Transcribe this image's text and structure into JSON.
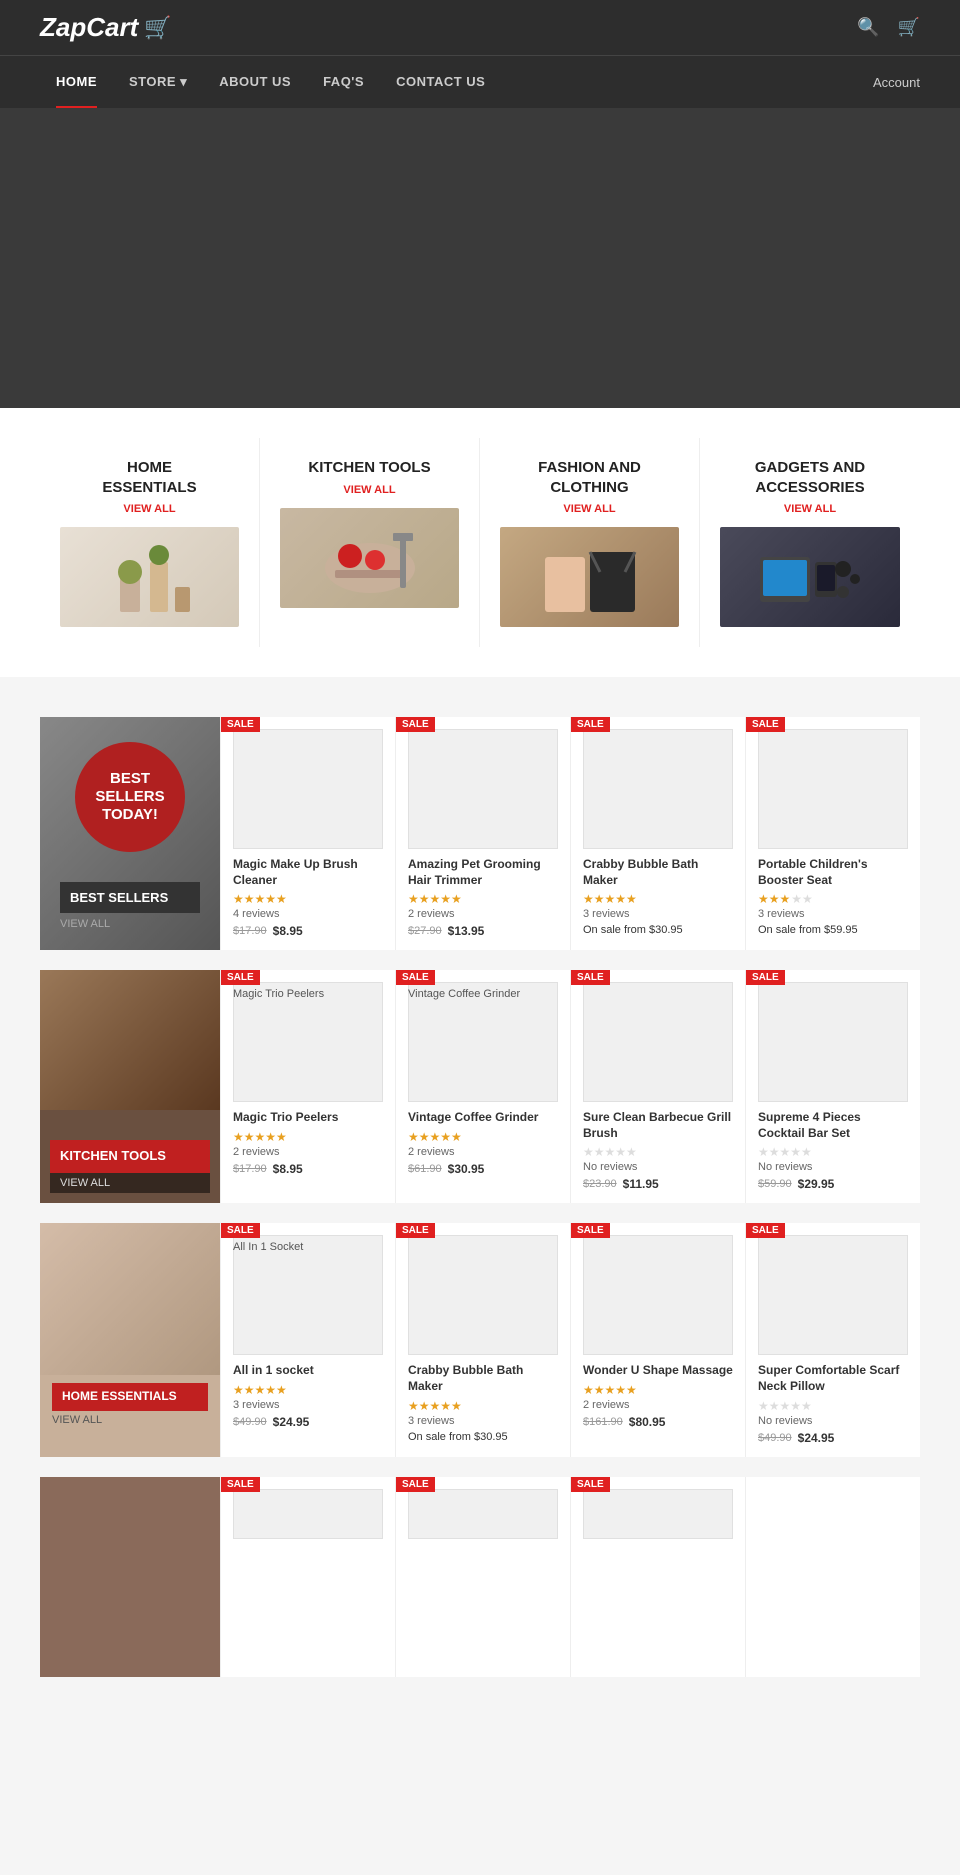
{
  "brand": {
    "name": "ZapCart",
    "cart_icon": "🛒"
  },
  "nav": {
    "items": [
      {
        "label": "HOME",
        "active": true
      },
      {
        "label": "STORE",
        "has_dropdown": true
      },
      {
        "label": "ABOUT US"
      },
      {
        "label": "FAQ'S"
      },
      {
        "label": "CONTACT US"
      }
    ],
    "account_label": "Account",
    "search_icon": "🔍",
    "cart_icon": "🛒"
  },
  "categories": [
    {
      "title": "HOME\nESSENTIALS",
      "view_all": "VIEW ALL",
      "type": "home"
    },
    {
      "title": "KITCHEN TOOLS",
      "view_all": "VIEW ALL",
      "type": "kitchen"
    },
    {
      "title": "FASHION AND CLOTHING",
      "view_all": "VIEW ALL",
      "type": "fashion"
    },
    {
      "title": "GADGETS AND ACCESSORIES",
      "view_all": "VIEW ALL",
      "type": "gadgets"
    }
  ],
  "best_sellers": {
    "banner": {
      "circle_text": "BEST SELLERS today!",
      "label": "BEST SELLERS",
      "view_all": "VIEW ALL"
    },
    "products": [
      {
        "name": "Magic Make Up Brush Cleaner",
        "stars": 5,
        "reviews": "4 reviews",
        "price_original": "$17.90",
        "price_sale": "$8.95",
        "has_sale": true,
        "sale_label": "SALE"
      },
      {
        "name": "Amazing Pet Grooming Hair Trimmer",
        "stars": 5,
        "reviews": "2 reviews",
        "price_original": "$27.90",
        "price_sale": "$13.95",
        "has_sale": true,
        "sale_label": "SALE"
      },
      {
        "name": "Crabby Bubble Bath Maker",
        "stars": 5,
        "reviews": "3 reviews",
        "price_from": "On sale from $30.95",
        "has_sale": true,
        "sale_label": "SALE"
      },
      {
        "name": "Portable Children's Booster Seat",
        "stars": 3,
        "reviews": "3 reviews",
        "price_from": "On sale from $59.95",
        "has_sale": true,
        "sale_label": "SALE"
      }
    ]
  },
  "kitchen_tools": {
    "banner": {
      "label": "KITCHEN TOOLS",
      "view_all": "VIEW ALL"
    },
    "products": [
      {
        "name": "Magic Trio Peelers",
        "text_label": "Magic Trio Peelers",
        "stars": 5,
        "reviews": "2 reviews",
        "price_original": "$17.90",
        "price_sale": "$8.95",
        "has_sale": true,
        "sale_label": "SALE"
      },
      {
        "name": "Vintage Coffee Grinder",
        "text_label": "Vintage Coffee Grinder",
        "stars": 5,
        "reviews": "2 reviews",
        "price_original": "$61.90",
        "price_sale": "$30.95",
        "has_sale": true,
        "sale_label": "SALE"
      },
      {
        "name": "Sure Clean Barbecue Grill Brush",
        "stars": 0,
        "reviews": "No reviews",
        "price_original": "$23.90",
        "price_sale": "$11.95",
        "has_sale": true,
        "sale_label": "SALE"
      },
      {
        "name": "Supreme 4 Pieces Cocktail Bar Set",
        "stars": 0,
        "reviews": "No reviews",
        "price_original": "$59.90",
        "price_sale": "$29.95",
        "has_sale": true,
        "sale_label": "SALE"
      }
    ]
  },
  "home_essentials": {
    "banner": {
      "label": "HOME ESSENTIALS",
      "view_all": "VIEW ALL"
    },
    "products": [
      {
        "name": "All in 1 socket",
        "text_label": "All In 1 Socket",
        "stars": 5,
        "reviews": "3 reviews",
        "price_original": "$49.90",
        "price_sale": "$24.95",
        "has_sale": true,
        "sale_label": "SALE"
      },
      {
        "name": "Crabby Bubble Bath Maker",
        "stars": 5,
        "reviews": "3 reviews",
        "price_from": "On sale from $30.95",
        "has_sale": true,
        "sale_label": "SALE"
      },
      {
        "name": "Wonder U Shape Massage",
        "stars": 5,
        "reviews": "2 reviews",
        "price_original": "$161.90",
        "price_sale": "$80.95",
        "has_sale": true,
        "sale_label": "SALE"
      },
      {
        "name": "Super Comfortable Scarf Neck Pillow",
        "stars": 0,
        "reviews": "No reviews",
        "price_original": "$49.90",
        "price_sale": "$24.95",
        "has_sale": true,
        "sale_label": "SALE"
      }
    ]
  },
  "last_row": {
    "products": [
      {
        "has_sale": true,
        "sale_label": "SALE"
      },
      {
        "has_sale": true,
        "sale_label": "SALE"
      },
      {
        "has_sale": true,
        "sale_label": "SALE"
      }
    ]
  }
}
